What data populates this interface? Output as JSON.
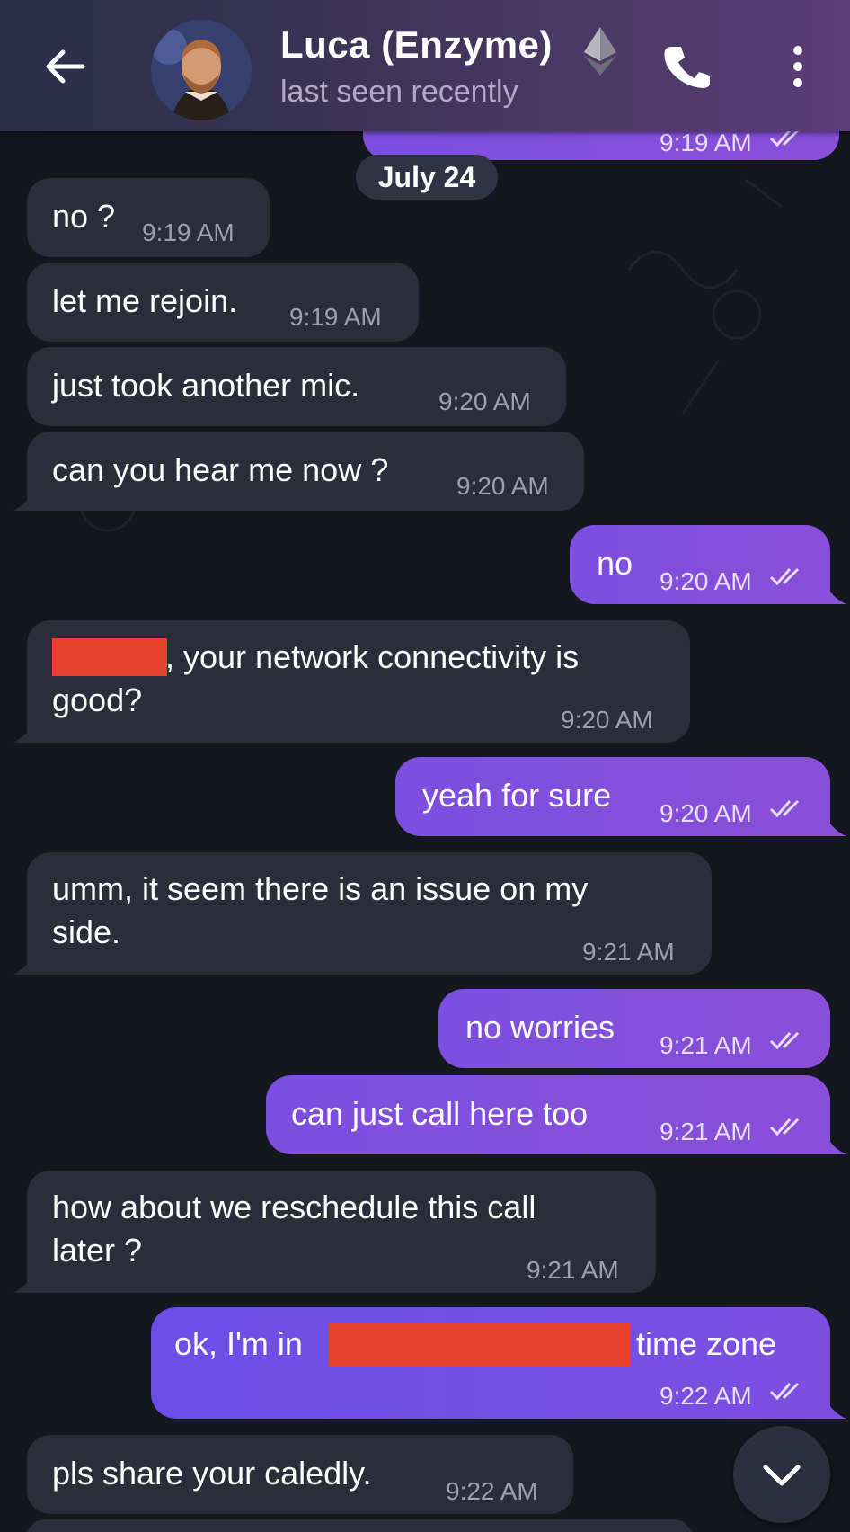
{
  "header": {
    "title": "Luca (Enzyme)",
    "status": "last seen recently",
    "icons": [
      "back-arrow-icon",
      "avatar",
      "ethereum-icon",
      "phone-icon",
      "more-vertical-icon"
    ]
  },
  "top_partial": {
    "time": "9:19 AM"
  },
  "date_chip": "July 24",
  "messages": [
    {
      "dir": "in",
      "text": "no ?",
      "time": "9:19 AM"
    },
    {
      "dir": "in",
      "text": "let me rejoin.",
      "time": "9:19 AM"
    },
    {
      "dir": "in",
      "text": "just took another mic.",
      "time": "9:20 AM"
    },
    {
      "dir": "in",
      "text": "can you hear me now ?",
      "time": "9:20 AM"
    },
    {
      "dir": "out",
      "text": "no",
      "time": "9:20 AM"
    },
    {
      "dir": "in",
      "text_line1": ", your network connectivity is",
      "text_line2": "good?",
      "time": "9:20 AM"
    },
    {
      "dir": "out",
      "text": "yeah for sure",
      "time": "9:20 AM"
    },
    {
      "dir": "in",
      "text_line1": "umm, it seem there is an issue on my",
      "text_line2": "side.",
      "time": "9:21 AM"
    },
    {
      "dir": "out",
      "text": "no worries",
      "time": "9:21 AM"
    },
    {
      "dir": "out",
      "text": "can just call here too",
      "time": "9:21 AM"
    },
    {
      "dir": "in",
      "text_line1": "how about we reschedule this call",
      "text_line2": "later ?",
      "time": "9:21 AM"
    },
    {
      "dir": "out",
      "text_part1": "ok, I'm in",
      "text_part2": "time zone",
      "time": "9:22 AM"
    },
    {
      "dir": "in",
      "text": "pls share your caledly.",
      "time": "9:22 AM"
    }
  ],
  "colors": {
    "incoming_bubble": "#2b2e3a",
    "outgoing_bubble": "#7c4fe0",
    "background": "#15171f",
    "redaction": "#e5402c"
  }
}
